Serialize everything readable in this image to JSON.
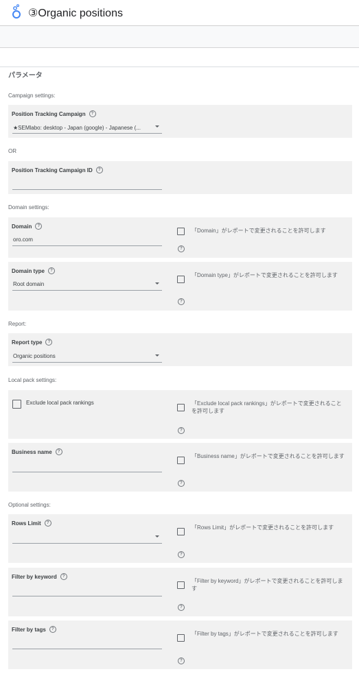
{
  "header": {
    "title": "③Organic positions",
    "logo_icon": "looker-studio-icon"
  },
  "params_title": "パラメータ",
  "sections": {
    "campaign": "Campaign settings:",
    "or": "OR",
    "domain": "Domain settings:",
    "report": "Report:",
    "local": "Local pack settings:",
    "optional": "Optional settings:"
  },
  "fields": {
    "campaign": {
      "label": "Position Tracking Campaign",
      "value": "★SEMlabo: desktop - Japan (google) - Japanese (..."
    },
    "campaign_id": {
      "label": "Position Tracking Campaign ID",
      "value": ""
    },
    "domain": {
      "label": "Domain",
      "value": "oro.com",
      "allow": "「Domain」がレポートで変更されることを許可します"
    },
    "domain_type": {
      "label": "Domain type",
      "value": "Root domain",
      "allow": "「Domain type」がレポートで変更されることを許可します"
    },
    "report_type": {
      "label": "Report type",
      "value": "Organic positions"
    },
    "exclude_local": {
      "label": "Exclude local pack rankings",
      "allow": "「Exclude local pack rankings」がレポートで変更されることを許可します"
    },
    "business_name": {
      "label": "Business name",
      "value": "",
      "allow": "「Business name」がレポートで変更されることを許可します"
    },
    "rows_limit": {
      "label": "Rows Limit",
      "value": "",
      "allow": "「Rows Limit」がレポートで変更されることを許可します"
    },
    "filter_keyword": {
      "label": "Filter by keyword",
      "value": "",
      "allow": "「Filter by keyword」がレポートで変更されることを許可します"
    },
    "filter_tags": {
      "label": "Filter by tags",
      "value": "",
      "allow": "「Filter by tags」がレポートで変更されることを許可します"
    }
  },
  "help_glyph": "?",
  "colors": {
    "card_bg": "#f1f1f1",
    "logo_blue": "#4285f4"
  }
}
